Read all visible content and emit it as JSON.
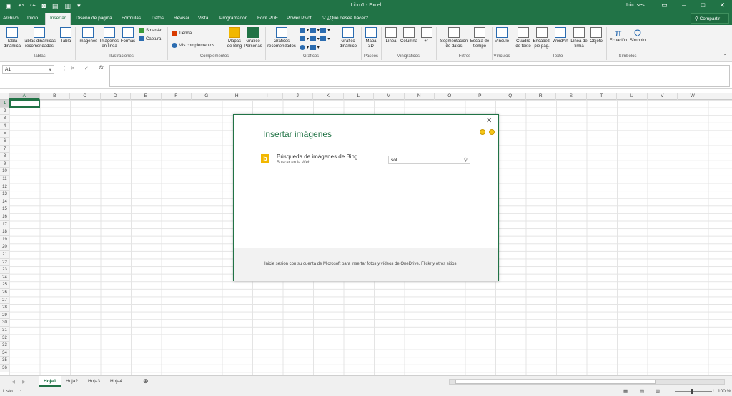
{
  "titlebar": {
    "title": "Libro1 - Excel",
    "login": "Inic. ses."
  },
  "tabs": [
    "Archivo",
    "Inicio",
    "Insertar",
    "Diseño de página",
    "Fórmulas",
    "Datos",
    "Revisar",
    "Vista",
    "Programador",
    "Foxit PDF",
    "Power Pivot"
  ],
  "active_tab": "Insertar",
  "tellme": "¿Qué desea hacer?",
  "share": "Compartir",
  "ribbon": {
    "tabla_dinamica": "Tabla dinámica",
    "tablas_recomendadas": "Tablas dinámicas recomendadas",
    "tabla": "Tabla",
    "imagenes": "Imágenes",
    "imagenes_linea": "Imágenes en línea",
    "formas": "Formas",
    "smartart": "SmartArt",
    "captura": "Captura",
    "tienda": "Tienda",
    "mis_complementos": "Mis complementos",
    "mapas_bing": "Mapas de Bing",
    "grafico_personas": "Gráfico Personas",
    "graficos_recomendados": "Gráficos recomendados",
    "grafico_dinamico": "Gráfico dinámico",
    "mapa_3d": "Mapa 3D",
    "linea": "Línea",
    "columna": "Columna",
    "ganancia": "+/-",
    "segmentacion": "Segmentación de datos",
    "escala_tiempo": "Escala de tiempo",
    "vinculo": "Vínculo",
    "cuadro_texto": "Cuadro de texto",
    "encabez": "Encabez. pie pág.",
    "wordart": "WordArt",
    "linea_firma": "Línea de firma",
    "objeto": "Objeto",
    "ecuacion": "Ecuación",
    "simbolo": "Símbolo",
    "groups": {
      "tablas": "Tablas",
      "ilustraciones": "Ilustraciones",
      "complementos": "Complementos",
      "graficos": "Gráficos",
      "paseos": "Paseos",
      "minigraficos": "Minigráficos",
      "filtros": "Filtros",
      "vinculos": "Vínculos",
      "texto": "Texto",
      "simbolos": "Símbolos"
    }
  },
  "formula": {
    "namebox": "A1",
    "fx": "fx"
  },
  "columns": [
    "A",
    "B",
    "C",
    "D",
    "E",
    "F",
    "G",
    "H",
    "I",
    "J",
    "K",
    "L",
    "M",
    "N",
    "O",
    "P",
    "Q",
    "R",
    "S",
    "T",
    "U",
    "V",
    "W"
  ],
  "rows": [
    "1",
    "2",
    "3",
    "4",
    "5",
    "6",
    "7",
    "8",
    "9",
    "10",
    "11",
    "12",
    "13",
    "14",
    "15",
    "16",
    "17",
    "18",
    "19",
    "20",
    "21",
    "22",
    "23",
    "24",
    "25",
    "26",
    "27",
    "28",
    "29",
    "30",
    "31",
    "32",
    "33",
    "34",
    "35",
    "36"
  ],
  "sheets": [
    "Hoja1",
    "Hoja2",
    "Hoja3",
    "Hoja4"
  ],
  "status": {
    "ready": "Listo",
    "zoom": "100 %"
  },
  "dialog": {
    "title": "Insertar imágenes",
    "bing_title": "Búsqueda de imágenes de Bing",
    "bing_sub": "Buscar en la Web",
    "search_value": "sol",
    "footer": "Inicie sesión con su cuenta de Microsoft para insertar fotos y vídeos de OneDrive, Flickr y otros sitios."
  }
}
